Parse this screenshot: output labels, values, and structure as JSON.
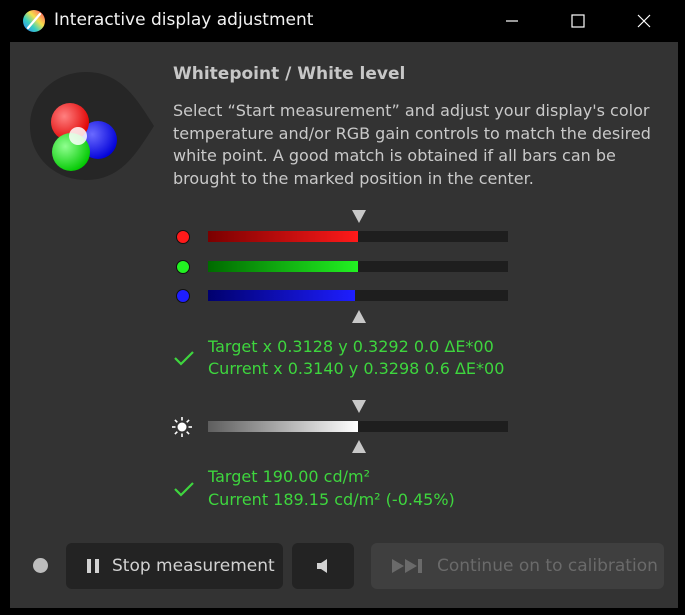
{
  "window": {
    "title": "Interactive display adjustment",
    "app_icon": "displaycal-icon",
    "controls": [
      "minimize-icon",
      "maximize-icon",
      "close-icon"
    ]
  },
  "main": {
    "heading": "Whitepoint / White level",
    "description": "Select “Start measurement” and adjust your display's color temperature and/or RGB gain controls to match the desired white point. A good match is obtained if all bars can be brought to the marked position in the center."
  },
  "rgb_bars": [
    {
      "channel": "red",
      "color": "#ff1a1a",
      "level": 0.5
    },
    {
      "channel": "green",
      "color": "#22f222",
      "level": 0.5
    },
    {
      "channel": "blue",
      "color": "#1e1eff",
      "level": 0.49
    }
  ],
  "whitepoint": {
    "target": "Target x 0.3128 y 0.3292 0.0 ΔE*00",
    "current": "Current x 0.3140 y 0.3298 0.6 ΔE*00",
    "status_icon": "checkmark-icon"
  },
  "luminance_bar": {
    "icon": "sun-icon",
    "level": 0.5
  },
  "white_level": {
    "target": "Target 190.00 cd/m²",
    "current": "Current 189.15 cd/m² (-0.45%)",
    "status_icon": "checkmark-icon"
  },
  "footer": {
    "stop_label": "Stop measurement",
    "stop_icon": "pause-icon",
    "sound_icon": "speaker-icon",
    "continue_label": "Continue on to calibration",
    "continue_icon": "skip-forward-icon",
    "continue_enabled": false
  },
  "colors": {
    "accent_green": "#3ed63e",
    "background": "#333333",
    "titlebar": "#000000"
  }
}
